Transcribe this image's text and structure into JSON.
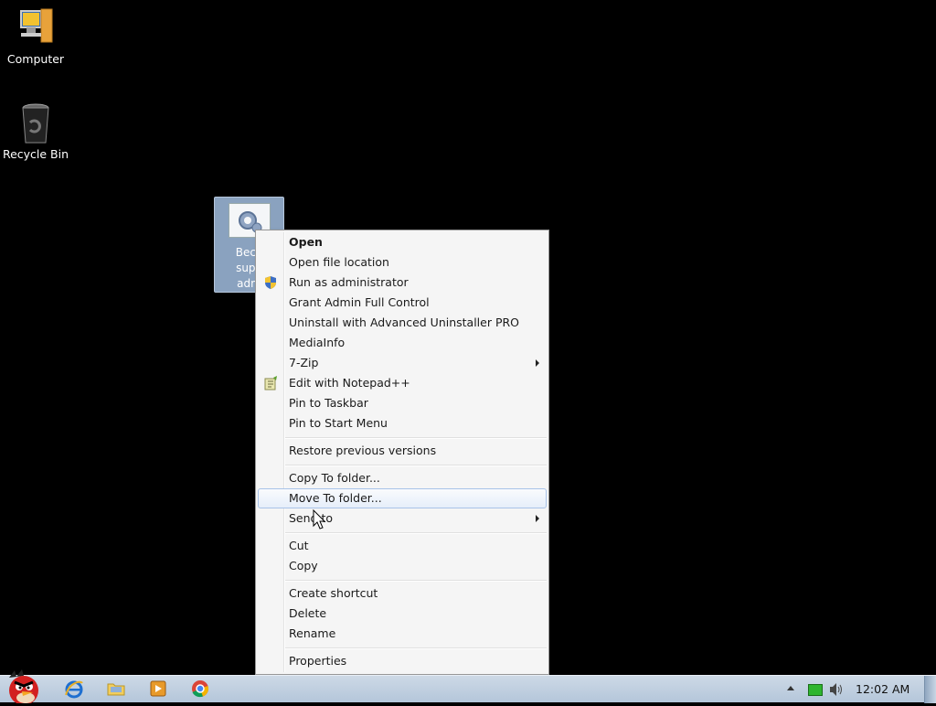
{
  "desktop": {
    "icons": [
      {
        "label": "Computer",
        "icon": "computer-icon"
      },
      {
        "label": "Recycle Bin",
        "icon": "recycle-bin-icon"
      }
    ],
    "selected_file": {
      "label": "Beco\nsupe\nadm",
      "icon": "settings-gear-file-icon"
    }
  },
  "context_menu": {
    "items": [
      {
        "label": "Open"
      },
      {
        "label": "Open file location"
      },
      {
        "label": "Run as administrator",
        "icon": "uac-shield-icon"
      },
      {
        "label": "Grant Admin Full Control"
      },
      {
        "label": "Uninstall with Advanced Uninstaller PRO"
      },
      {
        "label": "MediaInfo"
      },
      {
        "label": "7-Zip"
      },
      {
        "label": "Edit with Notepad++",
        "icon": "notepad-plus-plus-icon"
      },
      {
        "label": "Pin to Taskbar"
      },
      {
        "label": "Pin to Start Menu"
      },
      {
        "label": "Restore previous versions"
      },
      {
        "label": "Copy To folder..."
      },
      {
        "label": "Move To folder..."
      },
      {
        "label": "Send to"
      },
      {
        "label": "Cut"
      },
      {
        "label": "Copy"
      },
      {
        "label": "Create shortcut"
      },
      {
        "label": "Delete"
      },
      {
        "label": "Rename"
      },
      {
        "label": "Properties"
      }
    ],
    "highlighted": "Move To folder..."
  },
  "taskbar": {
    "pinned": [
      "angry-birds-start-icon",
      "internet-explorer-icon",
      "folder-icon",
      "media-player-icon",
      "chrome-icon"
    ],
    "tray": [
      "show-hidden-icons-arrow",
      "network-icon",
      "volume-icon"
    ],
    "clock": "12:02 AM"
  }
}
